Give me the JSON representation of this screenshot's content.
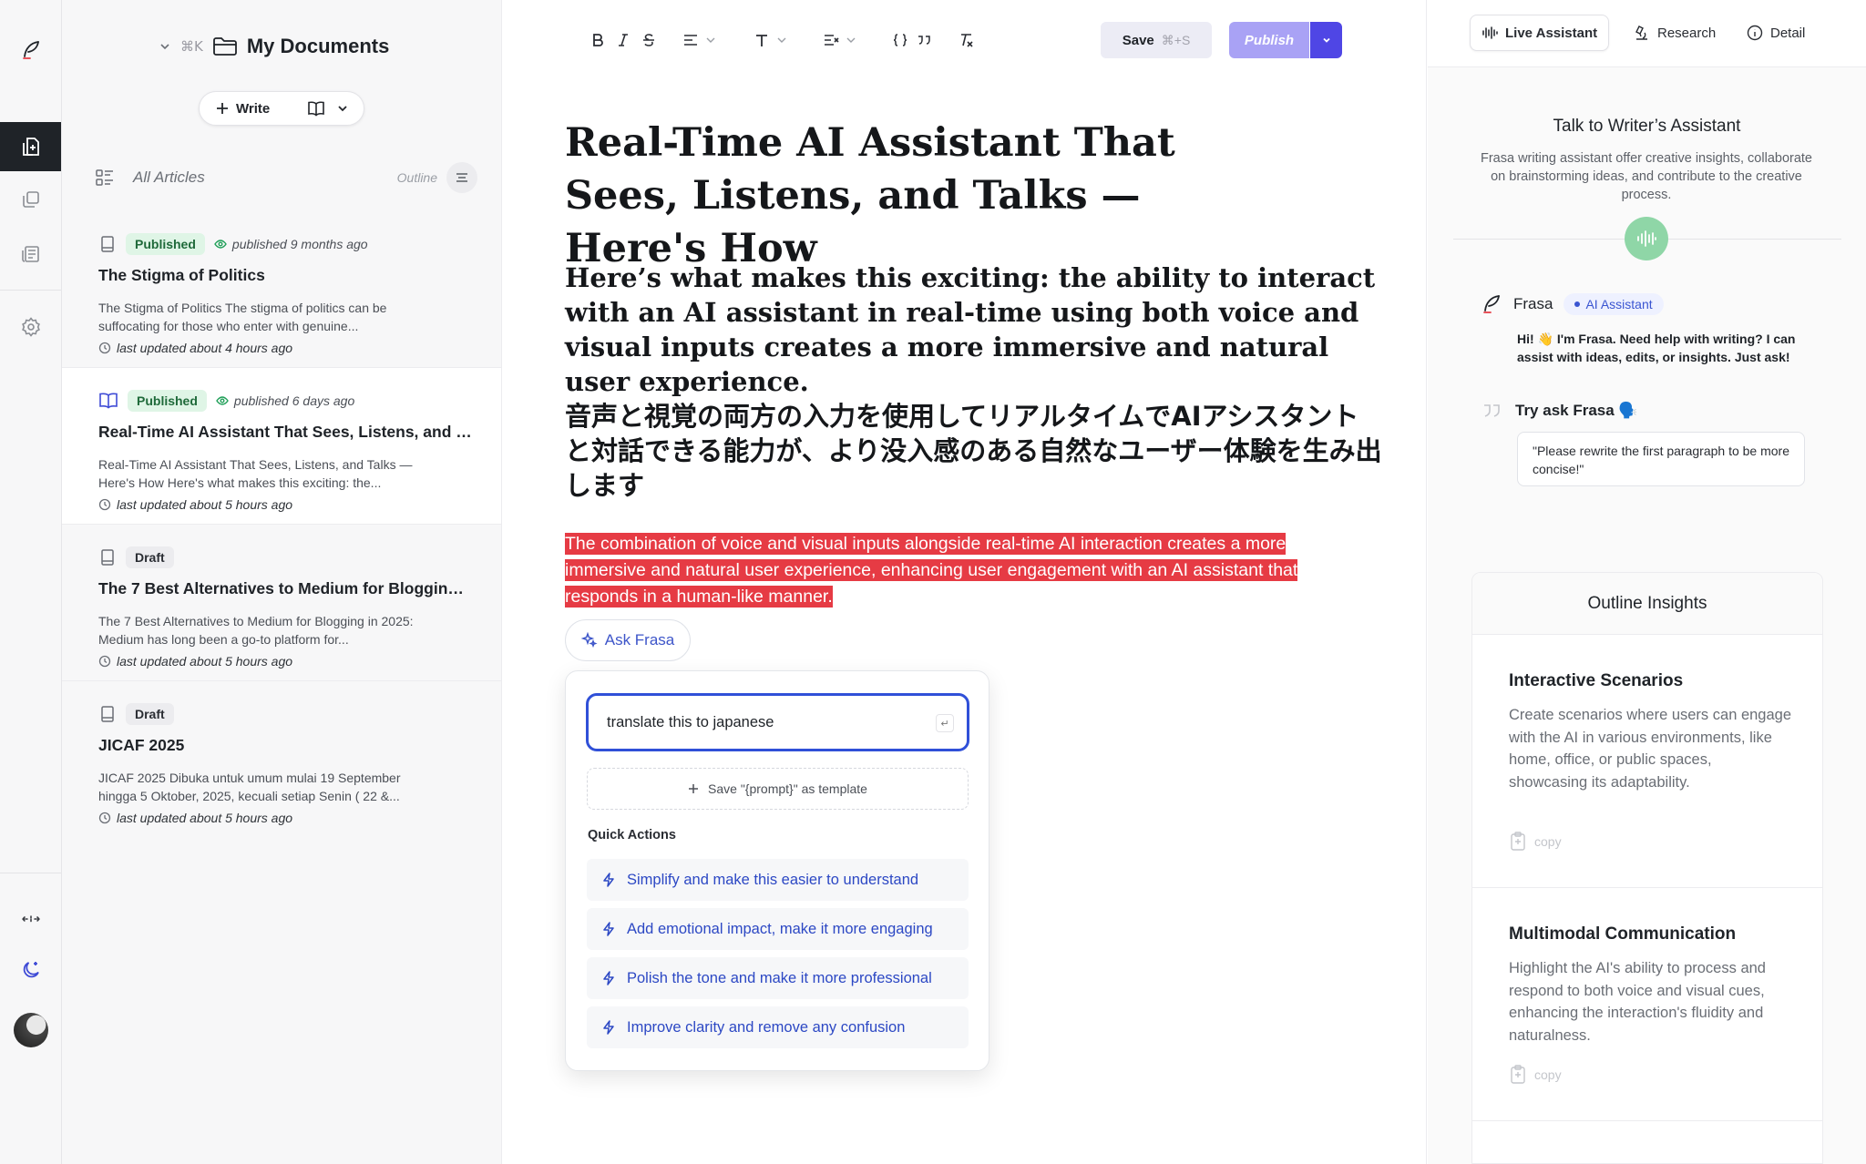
{
  "rail": {
    "icons": [
      "feather-logo-icon",
      "new-document-icon",
      "collection-icon",
      "newspaper-icon",
      "settings-icon",
      "expand-icon",
      "dark-mode-icon",
      "avatar"
    ]
  },
  "documents": {
    "shortcut": "⌘K",
    "title": "My Documents",
    "write_label": "Write",
    "list_label": "All Articles",
    "outline_label": "Outline",
    "articles": [
      {
        "status": "Published",
        "published": "published 9 months ago",
        "title": "The Stigma of Politics",
        "snippet": "The Stigma of Politics The stigma of politics can be suffocating for those who enter with genuine...",
        "updated": "last updated about 4 hours ago"
      },
      {
        "status": "Published",
        "published": "published 6 days ago",
        "title": "Real-Time AI Assistant That Sees, Listens, and Talks — Here's How",
        "snippet": "Real-Time AI Assistant That Sees, Listens, and Talks — Here's How Here's what makes this exciting: the...",
        "updated": "last updated about 5 hours ago"
      },
      {
        "status": "Draft",
        "published": "",
        "title": "The 7 Best Alternatives to Medium for Blogging in 2025",
        "snippet": "The 7 Best Alternatives to Medium for Blogging in 2025: Medium has long been a go-to platform for...",
        "updated": "last updated about 5 hours ago"
      },
      {
        "status": "Draft",
        "published": "",
        "title": "JICAF 2025",
        "snippet": "JICAF 2025 Dibuka untuk umum mulai 19 September hingga 5 Oktober, 2025, kecuali setiap Senin ( 22 &...",
        "updated": "last updated about 5 hours ago"
      }
    ]
  },
  "editor": {
    "save_label": "Save",
    "save_shortcut": "⌘+S",
    "publish_label": "Publish",
    "title": "Real-Time AI Assistant That Sees, Listens, and Talks — Here's How",
    "subheading": "Here’s what makes this exciting: the ability to interact with an AI assistant in real-time using both voice and visual inputs creates a more immersive and natural user experience.",
    "subheading_ja": "音声と視覚の両方の入力を使用してリアルタイムでAIアシスタントと対話できる能力が、より没入感のある自然なユーザー体験を生み出します",
    "highlighted": "The combination of voice and visual inputs alongside real-time AI interaction creates a more immersive and natural user experience, enhancing user engagement with an AI assistant that responds in a human-like manner.",
    "ask_label": "Ask Frasa",
    "prompt_value": "translate this to japanese",
    "save_template_label": "Save \"{prompt}\" as template",
    "quick_actions_title": "Quick Actions",
    "quick_actions": [
      "Simplify and make this easier to understand",
      "Add emotional impact, make it more engaging",
      "Polish the tone and make it more professional",
      "Improve clarity and remove any confusion"
    ]
  },
  "assistant": {
    "tabs": [
      "Live Assistant",
      "Research",
      "Detail"
    ],
    "title": "Talk to Writer’s Assistant",
    "subtitle": "Frasa writing assistant offer creative insights, collaborate on brainstorming ideas, and contribute to the creative process.",
    "bot_name": "Frasa",
    "bot_badge": "AI Assistant",
    "bot_message": "Hi! 👋 I'm Frasa. Need help with writing? I can assist with ideas, edits, or insights. Just ask!",
    "try_label": "Try ask Frasa 🗣️",
    "try_prompt": "\"Please rewrite the first paragraph to be more concise!\"",
    "insights_title": "Outline Insights",
    "copy_label": "copy",
    "insights": [
      {
        "title": "Interactive Scenarios",
        "body": "Create scenarios where users can engage with the AI in various environments, like home, office, or public spaces, showcasing its adaptability."
      },
      {
        "title": "Multimodal Communication",
        "body": "Highlight the AI's ability to process and respond to both voice and visual cues, enhancing the interaction's fluidity and naturalness."
      }
    ]
  },
  "colors": {
    "accent": "#4f46e5",
    "highlight": "#e63b44",
    "published_badge": "#dff5e6",
    "voice": "#8fd6a7"
  }
}
